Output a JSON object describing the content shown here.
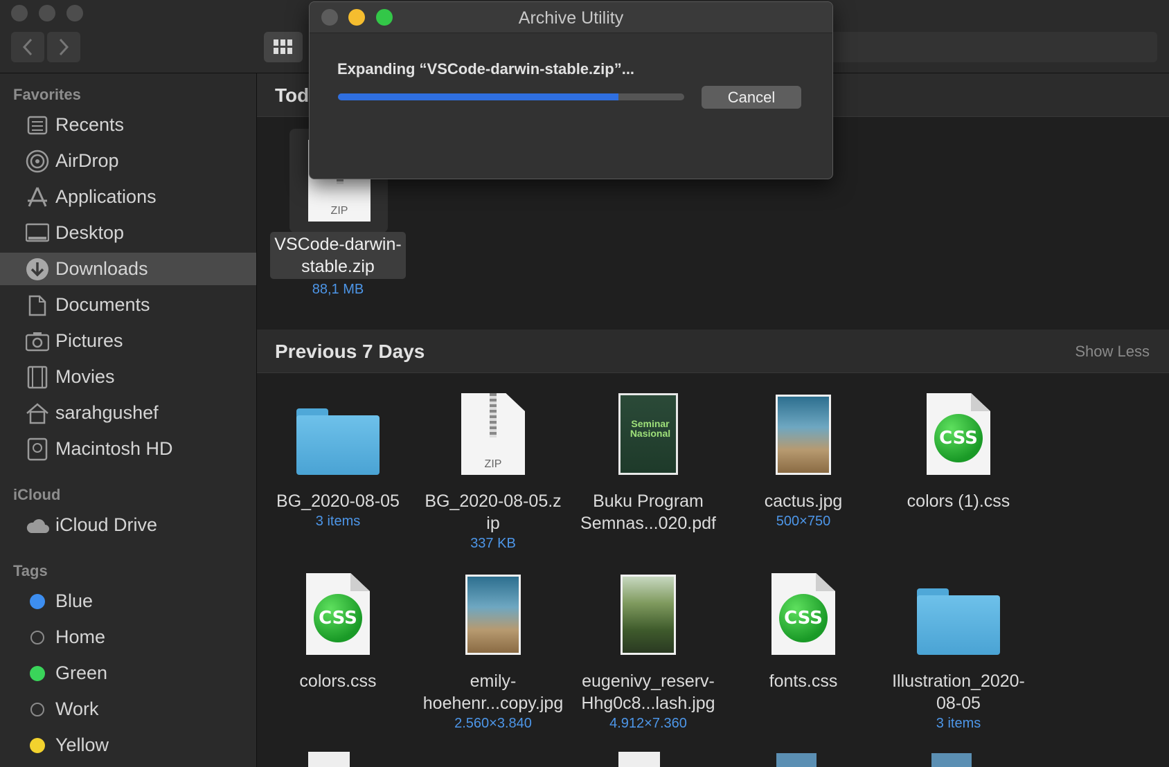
{
  "dialog": {
    "title": "Archive Utility",
    "message": "Expanding “VSCode-darwin-stable.zip”...",
    "progress": 0.81,
    "cancel_label": "Cancel"
  },
  "sidebar": {
    "favorites_title": "Favorites",
    "favorites": [
      {
        "label": "Recents",
        "icon": "recents-icon"
      },
      {
        "label": "AirDrop",
        "icon": "airdrop-icon"
      },
      {
        "label": "Applications",
        "icon": "applications-icon"
      },
      {
        "label": "Desktop",
        "icon": "desktop-icon"
      },
      {
        "label": "Downloads",
        "icon": "downloads-icon"
      },
      {
        "label": "Documents",
        "icon": "documents-icon"
      },
      {
        "label": "Pictures",
        "icon": "pictures-icon"
      },
      {
        "label": "Movies",
        "icon": "movies-icon"
      },
      {
        "label": "sarahgushef",
        "icon": "home-icon"
      },
      {
        "label": "Macintosh HD",
        "icon": "disk-icon"
      }
    ],
    "icloud_title": "iCloud",
    "icloud": [
      {
        "label": "iCloud Drive",
        "icon": "cloud-icon"
      }
    ],
    "tags_title": "Tags",
    "tags": [
      {
        "label": "Blue",
        "color": "#3d8ef0"
      },
      {
        "label": "Home",
        "color": ""
      },
      {
        "label": "Green",
        "color": "#3ad45a"
      },
      {
        "label": "Work",
        "color": ""
      },
      {
        "label": "Yellow",
        "color": "#f2d22e"
      }
    ]
  },
  "today": {
    "title": "Tod",
    "file": {
      "name_line1": "VSCode-darwin-",
      "name_line2": "stable.zip",
      "meta": "88,1 MB",
      "zip_label": "ZIP"
    }
  },
  "previous": {
    "title": "Previous 7 Days",
    "show_less": "Show Less",
    "files": [
      {
        "name1": "BG_2020-08-05",
        "name2": "",
        "meta": "3 items",
        "kind": "folder"
      },
      {
        "name1": "BG_2020-08-05.z",
        "name2": "ip",
        "meta": "337 KB",
        "kind": "zip"
      },
      {
        "name1": "Buku Program",
        "name2": "Semnas...020.pdf",
        "meta": "",
        "kind": "pdf"
      },
      {
        "name1": "cactus.jpg",
        "name2": "",
        "meta": "500×750",
        "kind": "photo-desert"
      },
      {
        "name1": "colors (1).css",
        "name2": "",
        "meta": "",
        "kind": "css"
      },
      {
        "name1": "colors.css",
        "name2": "",
        "meta": "",
        "kind": "css"
      },
      {
        "name1": "emily-",
        "name2": "hoehenr...copy.jpg",
        "meta": "2.560×3.840",
        "kind": "photo-desert"
      },
      {
        "name1": "eugenivy_reserv-",
        "name2": "Hhg0c8...lash.jpg",
        "meta": "4.912×7.360",
        "kind": "photo-garden"
      },
      {
        "name1": "fonts.css",
        "name2": "",
        "meta": "",
        "kind": "css"
      },
      {
        "name1": "Illustration_2020-",
        "name2": "08-05",
        "meta": "3 items",
        "kind": "folder"
      }
    ],
    "css_badge": "CSS",
    "zip_label": "ZIP",
    "pdf_cover_text": "Seminar Nasional"
  }
}
